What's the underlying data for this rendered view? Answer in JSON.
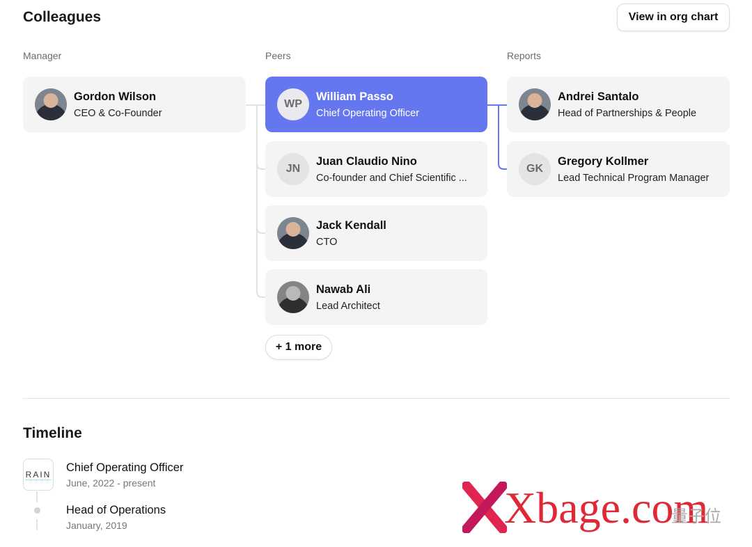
{
  "colleagues": {
    "title": "Colleagues",
    "org_chart_button": "View in org chart",
    "manager_label": "Manager",
    "peers_label": "Peers",
    "reports_label": "Reports",
    "manager": {
      "name": "Gordon Wilson",
      "title": "CEO & Co-Founder"
    },
    "peers": [
      {
        "name": "William Passo",
        "title": "Chief Operating Officer",
        "initials": "WP",
        "selected": true
      },
      {
        "name": "Juan Claudio Nino",
        "title": "Co-founder and Chief Scientific ...",
        "initials": "JN"
      },
      {
        "name": "Jack Kendall",
        "title": "CTO"
      },
      {
        "name": "Nawab Ali",
        "title": "Lead Architect"
      }
    ],
    "more_button": "+ 1 more",
    "reports": [
      {
        "name": "Andrei Santalo",
        "title": "Head of Partnerships & People"
      },
      {
        "name": "Gregory Kollmer",
        "title": "Lead Technical Program Manager",
        "initials": "GK"
      }
    ]
  },
  "timeline": {
    "title": "Timeline",
    "items": [
      {
        "role": "Chief Operating Officer",
        "dates": "June, 2022 - present",
        "logo": "RAIN"
      },
      {
        "role": "Head of Operations",
        "dates": "January, 2019"
      }
    ]
  },
  "watermark": {
    "text": "Xbage.com",
    "secondary": "量子位"
  },
  "colors": {
    "accent": "#6577ee",
    "card": "#f4f4f5"
  }
}
